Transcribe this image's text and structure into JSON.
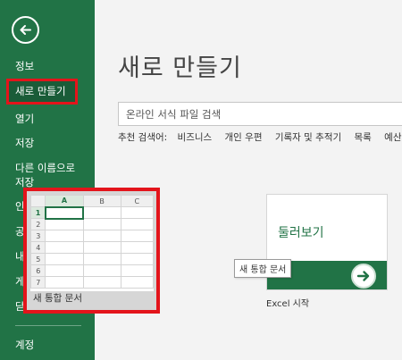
{
  "sidebar": {
    "items": [
      {
        "label": "정보"
      },
      {
        "label": "새로 만들기"
      },
      {
        "label": "열기"
      },
      {
        "label": "저장"
      },
      {
        "label": "다른 이름으로 저장"
      },
      {
        "label": "인쇄"
      },
      {
        "label": "공유"
      },
      {
        "label": "내보내기"
      },
      {
        "label": "게시"
      },
      {
        "label": "닫기"
      },
      {
        "label": "계정"
      }
    ],
    "colors": {
      "background": "#217346",
      "active": "#1a5c38",
      "highlight": "#e3141b"
    }
  },
  "main": {
    "title": "새로 만들기",
    "search": {
      "placeholder": "온라인 서식 파일 검색"
    },
    "suggested": {
      "label": "추천 검색어:",
      "items": [
        "비즈니스",
        "개인 우편",
        "기록자 및 추적기",
        "목록",
        "예산"
      ]
    },
    "templates": {
      "blank": {
        "caption": "새 통합 문서",
        "tooltip": "새 통합 문서",
        "columns": [
          "A",
          "B",
          "C"
        ],
        "rows": [
          "1",
          "2",
          "3",
          "4",
          "5",
          "6",
          "7"
        ]
      },
      "tour": {
        "title": "둘러보기",
        "caption": "Excel 시작"
      }
    }
  }
}
